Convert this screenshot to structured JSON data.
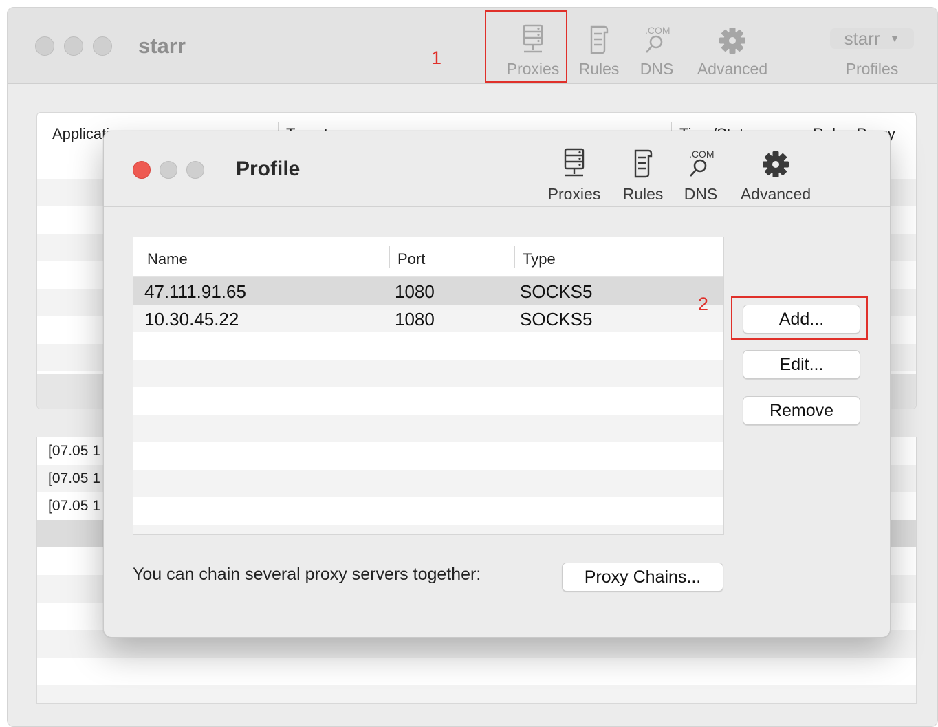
{
  "main_window": {
    "title": "starr",
    "toolbar": [
      {
        "id": "proxies",
        "label": "Proxies",
        "icon": "server-icon"
      },
      {
        "id": "rules",
        "label": "Rules",
        "icon": "rules-icon"
      },
      {
        "id": "dns",
        "label": "DNS",
        "icon": "dns-icon"
      },
      {
        "id": "advanced",
        "label": "Advanced",
        "icon": "gear-icon"
      }
    ],
    "profile_selector": {
      "value": "starr",
      "label": "Profiles"
    },
    "connections_table": {
      "columns": [
        "Application",
        "Target",
        "Time/Status",
        "Rule : Proxy"
      ]
    },
    "log_entries": [
      "[07.05 1",
      "[07.05 1",
      "[07.05 1"
    ]
  },
  "annotations": {
    "step1": "1",
    "step2": "2"
  },
  "dialog": {
    "title": "Profile",
    "toolbar": [
      {
        "id": "proxies",
        "label": "Proxies",
        "icon": "server-icon"
      },
      {
        "id": "rules",
        "label": "Rules",
        "icon": "rules-icon"
      },
      {
        "id": "dns",
        "label": "DNS",
        "icon": "dns-icon"
      },
      {
        "id": "advanced",
        "label": "Advanced",
        "icon": "gear-icon"
      }
    ],
    "proxy_table": {
      "columns": [
        "Name",
        "Port",
        "Type"
      ],
      "rows": [
        {
          "name": "47.111.91.65",
          "port": "1080",
          "type": "SOCKS5",
          "selected": true
        },
        {
          "name": "10.30.45.22",
          "port": "1080",
          "type": "SOCKS5",
          "selected": false
        }
      ]
    },
    "buttons": {
      "add": "Add...",
      "edit": "Edit...",
      "remove": "Remove"
    },
    "chain_text": "You can chain several proxy servers together:",
    "chain_button": "Proxy Chains..."
  },
  "colors": {
    "annotation_red": "#e0302a",
    "close_light": "#ee5a52",
    "selected_row": "#dadada"
  }
}
